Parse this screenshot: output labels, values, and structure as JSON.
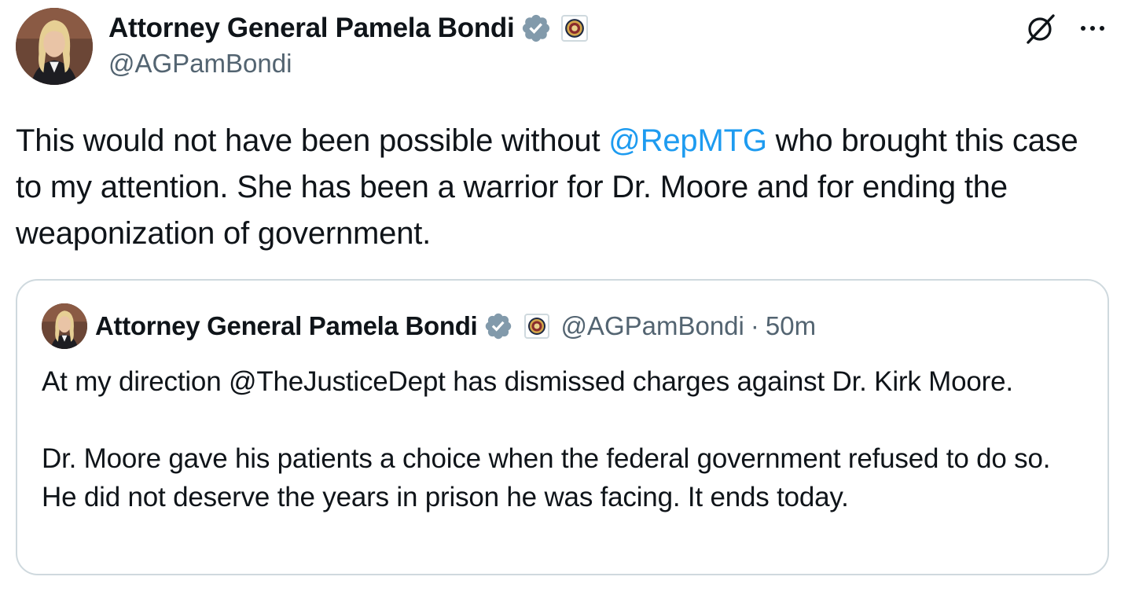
{
  "tweet": {
    "author": {
      "display_name": "Attorney General Pamela Bondi",
      "handle": "@AGPamBondi",
      "verified_icon": "verified-badge-icon",
      "affiliation_icon": "doj-seal-icon"
    },
    "text_parts": {
      "before": "This would not have been possible without ",
      "mention": "@RepMTG",
      "after": " who brought this case to my attention. She has been a warrior for Dr. Moore and for ending the weaponization of government."
    },
    "icons": {
      "grok": "grok-icon",
      "more": "more-options-icon"
    }
  },
  "quoted_tweet": {
    "author": {
      "display_name": "Attorney General Pamela Bondi",
      "handle": "@AGPamBondi",
      "separator": "·",
      "time": "50m"
    },
    "text": "At my direction @TheJusticeDept has dismissed charges against Dr. Kirk Moore.\n\nDr. Moore gave his patients a choice when the federal government refused to do so. He did not deserve the years in prison he was facing. It ends today."
  },
  "colors": {
    "text": "#0f1419",
    "secondary": "#536471",
    "link": "#1d9bf0",
    "border": "#cfd9de",
    "verified_badge": "#829aab"
  }
}
